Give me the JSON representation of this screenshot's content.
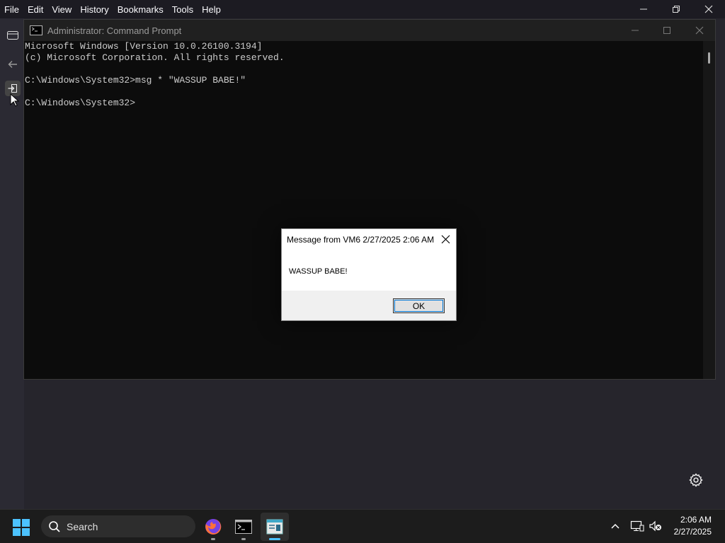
{
  "menubar": {
    "items": [
      "File",
      "Edit",
      "View",
      "History",
      "Bookmarks",
      "Tools",
      "Help"
    ]
  },
  "cmd": {
    "title": "Administrator: Command Prompt",
    "lines": [
      "Microsoft Windows [Version 10.0.26100.3194]",
      "(c) Microsoft Corporation. All rights reserved.",
      "",
      "C:\\Windows\\System32>msg * \"WASSUP BABE!\"",
      "",
      "C:\\Windows\\System32>"
    ]
  },
  "dialog": {
    "title": "Message from VM6 2/27/2025 2:06 AM",
    "message": "WASSUP BABE!",
    "ok_label": "OK"
  },
  "taskbar": {
    "search_label": "Search",
    "time": "2:06 AM",
    "date": "2/27/2025",
    "apps": [
      "firefox-icon",
      "command-prompt-icon",
      "notepad-icon"
    ]
  },
  "colors": {
    "accent": "#4cc2ff",
    "console_bg": "#0c0c0c",
    "console_text": "#cccccc"
  }
}
